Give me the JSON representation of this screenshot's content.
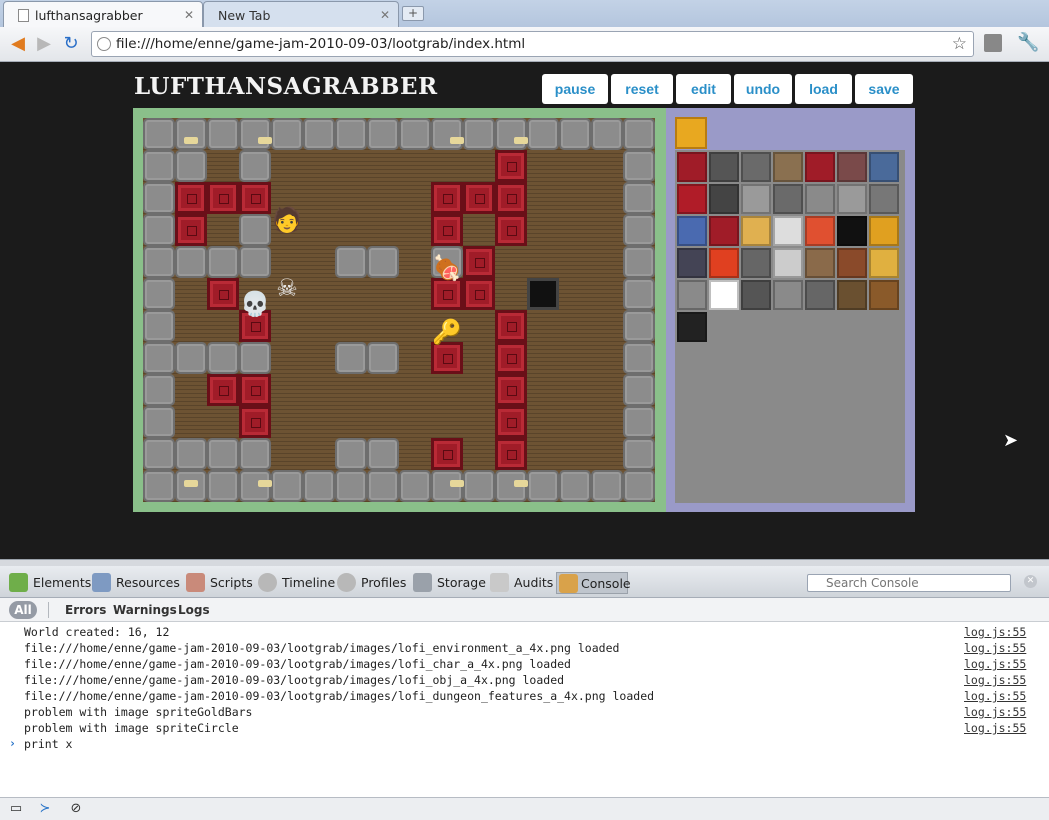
{
  "browser": {
    "tabs": [
      {
        "title": "lufthansagrabber",
        "active": true
      },
      {
        "title": "New Tab",
        "active": false
      }
    ],
    "url": "file:///home/enne/game-jam-2010-09-03/lootgrab/index.html",
    "icons": [
      "back-icon",
      "forward-icon",
      "reload-icon",
      "star-icon",
      "page-action-icon",
      "wrench-icon"
    ]
  },
  "game": {
    "title": "LUFTHANSAGRABBER",
    "buttons": [
      "pause",
      "reset",
      "edit",
      "undo",
      "load",
      "save"
    ],
    "world": {
      "cols": 16,
      "rows": 12
    },
    "colors": {
      "border_play": "#8ac08a",
      "border_edit": "#9a9ac8",
      "button_text": "#2a8fc8"
    }
  },
  "devtools": {
    "panels": [
      "Elements",
      "Resources",
      "Scripts",
      "Timeline",
      "Profiles",
      "Storage",
      "Audits",
      "Console"
    ],
    "active_panel": "Console",
    "search_placeholder": "Search Console",
    "filters": [
      "All",
      "Errors",
      "Warnings",
      "Logs"
    ],
    "log": [
      {
        "text": "World created: 16, 12",
        "src": "log.js:55"
      },
      {
        "text": "file:///home/enne/game-jam-2010-09-03/lootgrab/images/lofi_environment_a_4x.png loaded",
        "src": "log.js:55"
      },
      {
        "text": "file:///home/enne/game-jam-2010-09-03/lootgrab/images/lofi_char_a_4x.png loaded",
        "src": "log.js:55"
      },
      {
        "text": "file:///home/enne/game-jam-2010-09-03/lootgrab/images/lofi_obj_a_4x.png loaded",
        "src": "log.js:55"
      },
      {
        "text": "file:///home/enne/game-jam-2010-09-03/lootgrab/images/lofi_dungeon_features_a_4x.png loaded",
        "src": "log.js:55"
      },
      {
        "text": "problem with image spriteGoldBars",
        "src": "log.js:55"
      },
      {
        "text": "problem with image spriteCircle",
        "src": "log.js:55"
      }
    ],
    "console_input": "print x"
  }
}
